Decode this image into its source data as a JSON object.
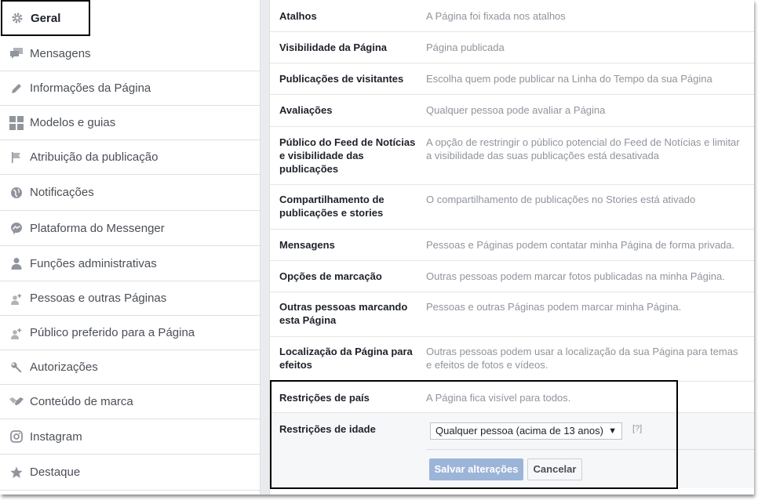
{
  "sidebar": {
    "items": [
      {
        "label": "Geral",
        "icon": "gear-icon",
        "active": true
      },
      {
        "label": "Mensagens",
        "icon": "chat-bubbles-icon"
      },
      {
        "label": "Informações da Página",
        "icon": "pencil-icon"
      },
      {
        "label": "Modelos e guias",
        "icon": "grid-icon"
      },
      {
        "label": "Atribuição da publicação",
        "icon": "flag-icon"
      },
      {
        "label": "Notificações",
        "icon": "globe-icon"
      },
      {
        "label": "Plataforma do Messenger",
        "icon": "messenger-icon"
      },
      {
        "label": "Funções administrativas",
        "icon": "person-icon"
      },
      {
        "label": "Pessoas e outras Páginas",
        "icon": "add-person-icon"
      },
      {
        "label": "Público preferido para a Página",
        "icon": "add-person-icon"
      },
      {
        "label": "Autorizações",
        "icon": "wrench-icon"
      },
      {
        "label": "Conteúdo de marca",
        "icon": "handshake-icon"
      },
      {
        "label": "Instagram",
        "icon": "instagram-icon"
      },
      {
        "label": "Destaque",
        "icon": "star-icon"
      }
    ]
  },
  "settings": {
    "rows": [
      {
        "label": "Atalhos",
        "value": "A Página foi fixada nos atalhos"
      },
      {
        "label": "Visibilidade da Página",
        "value": "Página publicada"
      },
      {
        "label": "Publicações de visitantes",
        "value": "Escolha quem pode publicar na Linha do Tempo da sua Página"
      },
      {
        "label": "Avaliações",
        "value": "Qualquer pessoa pode avaliar a Página"
      },
      {
        "label": "Público do Feed de Notícias e visibilidade das publicações",
        "value": "A opção de restringir o público potencial do Feed de Notícias e limitar a visibilidade das suas publicações está desativada"
      },
      {
        "label": "Compartilhamento de publicações e stories",
        "value": "O compartilhamento de publicações no Stories está ativado"
      },
      {
        "label": "Mensagens",
        "value": "Pessoas e Páginas podem contatar minha Página de forma privada."
      },
      {
        "label": "Opções de marcação",
        "value": "Outras pessoas podem marcar fotos publicadas na minha Página."
      },
      {
        "label": "Outras pessoas marcando esta Página",
        "value": "Pessoas e outras Páginas podem marcar minha Página."
      },
      {
        "label": "Localização da Página para efeitos",
        "value": "Outras pessoas podem usar a localização da sua Página para temas e efeitos de fotos e vídeos."
      },
      {
        "label": "Restrições de país",
        "value": "A Página fica visível para todos."
      }
    ],
    "age_restriction": {
      "label": "Restrições de idade",
      "selected": "Qualquer pessoa (acima de 13 anos)",
      "help": "[?]",
      "save_label": "Salvar alterações",
      "cancel_label": "Cancelar"
    }
  }
}
